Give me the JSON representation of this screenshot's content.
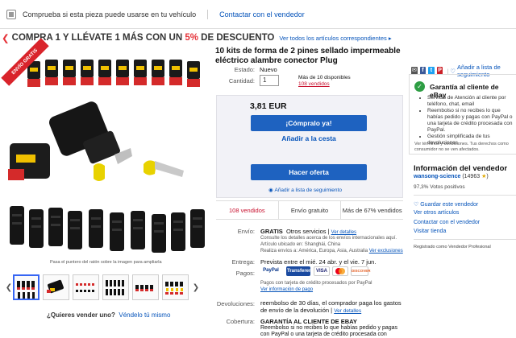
{
  "topbar": {
    "compat_text": "Comprueba si esta pieza puede usarse en tu vehículo",
    "contact_seller": "Contactar con el vendedor"
  },
  "promo": {
    "headline_part1": "COMPRA 1 Y LLÉVATE 1 MÁS CON UN",
    "headline_pct": "5%",
    "headline_part2": "DE DESCUENTO",
    "all_items_link": "Ver todos los artículos correspondientes ▸"
  },
  "gallery": {
    "ribbon": "ENVÍO GRATIS",
    "caption": "Pasa el puntero del ratón sobre la imagen para ampliarla",
    "sell_question": "¿Quieres vender uno?",
    "sell_link": "Véndelo tú mismo",
    "thumb_count": 6
  },
  "listing": {
    "title": "10 kits de forma de 2 pines sellado impermeable eléctrico alambre conector Plug",
    "add_watchlist": "Añadir a lista de seguimiento",
    "condition_label": "Estado:",
    "condition_value": "Nuevo",
    "quantity_label": "Cantidad:",
    "quantity_value": "1",
    "available": "Más de 10 disponibles",
    "sold": "108 vendidos",
    "price": "3,81 EUR",
    "buy_now": "¡Cómpralo ya!",
    "add_cart": "Añadir a la cesta",
    "make_offer": "Hacer oferta",
    "watch_link": "Añadir a lista de seguimiento",
    "stat_sold": "108 vendidos",
    "stat_shipping": "Envío gratuito",
    "stat_percent": "Más de 67% vendidos"
  },
  "details": {
    "shipping_label": "Envío:",
    "shipping_value": "GRATIS",
    "shipping_service": "Otros servicios |",
    "shipping_details_link": "Ver detalles",
    "shipping_note1": "Consulte los detalles acerca de los envíos internacionales aquí.",
    "shipping_note2": "Artículo ubicado en: Shanghái, China",
    "shipping_note3": "Realiza envíos a: América, Europa, Asia, Australia",
    "exclusions_link": "Ver exclusiones",
    "delivery_label": "Entrega:",
    "delivery_value": "Prevista entre el mié. 24 abr. y el vie. 7 jun.",
    "payments_label": "Pagos:",
    "payments_note": "Pagos con tarjeta de crédito procesados por PayPal",
    "payments_info_link": "Ver información de pago",
    "returns_label": "Devoluciones:",
    "returns_value": "reembolso de 30 días, el comprador paga los gastos de envío de la devolución |",
    "returns_link": "Ver detalles",
    "coverage_label": "Cobertura:",
    "coverage_value": "GARANTÍA AL CLIENTE DE EBAY",
    "coverage_note": "Reembolso si no recibes lo que habías pedido y pagas con PayPal o una tarjeta de crédito procesada con",
    "pay_methods": [
      "PayPal",
      "Transferencia",
      "VISA",
      "MasterCard",
      "DISCOVER"
    ]
  },
  "guarantee": {
    "title": "Garantía al cliente de eBay",
    "items": [
      "Servicio de Atención al cliente por teléfono, chat, email",
      "Reembolso si no recibes lo que habías pedido y pagas con PayPal o una tarjeta de crédito procesada con PayPal.",
      "Gestión simplificada de tus devoluciones"
    ],
    "terms_line1": "Ver términos y condiciones. Tus derechos como",
    "terms_line2": "consumidor no se ven afectados."
  },
  "seller": {
    "section_title": "Información del vendedor",
    "name": "wansong-science",
    "score": "(14963",
    "positive": "97,3% Votos positivos",
    "save_seller": "Guardar este vendedor",
    "other_items": "Ver otros artículos",
    "contact": "Contactar con el vendedor",
    "store": "Visitar tienda",
    "registered": "Registrado como Vendedor Profesional"
  },
  "colors": {
    "ebay_blue": "#0654ba",
    "button_blue": "#1e62c0",
    "promo_red": "#e53238",
    "guarantee_green": "#2e9e44"
  }
}
